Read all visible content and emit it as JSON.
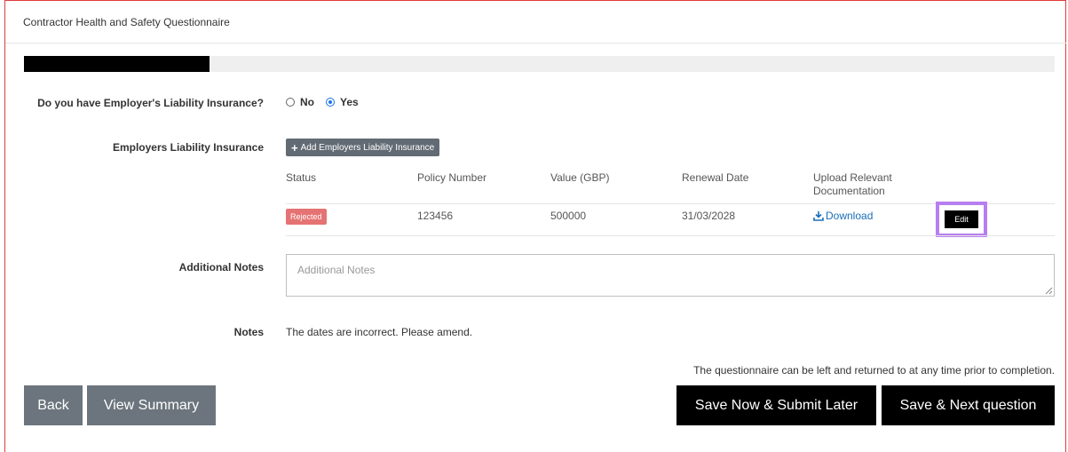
{
  "header": {
    "title": "Contractor Health and Safety Questionnaire"
  },
  "progress": {
    "fraction": 0.18
  },
  "question": {
    "label": "Do you have Employer's Liability Insurance?",
    "options": [
      {
        "label": "No",
        "selected": false
      },
      {
        "label": "Yes",
        "selected": true
      }
    ]
  },
  "insurance": {
    "label": "Employers Liability Insurance",
    "add_button_label": "Add Employers Liability Insurance",
    "columns": [
      "Status",
      "Policy Number",
      "Value (GBP)",
      "Renewal Date",
      "Upload Relevant Documentation"
    ],
    "rows": [
      {
        "status": "Rejected",
        "policy_number": "123456",
        "value": "500000",
        "renewal_date": "31/03/2028",
        "download_label": "Download",
        "edit_label": "Edit"
      }
    ]
  },
  "additional_notes": {
    "label": "Additional Notes",
    "placeholder": "Additional Notes",
    "value": ""
  },
  "notes": {
    "label": "Notes",
    "text": "The dates are incorrect. Please amend."
  },
  "footer": {
    "message": "The questionnaire can be left and returned to at any time prior to completion.",
    "back_label": "Back",
    "view_summary_label": "View Summary",
    "save_later_label": "Save Now & Submit Later",
    "save_next_label": "Save & Next question"
  },
  "colors": {
    "progress_fill": "#000000",
    "rejected_badge": "#e57373",
    "edit_highlight": "#b77ff0",
    "link": "#1a6fb8"
  },
  "icons": [
    "plus-icon",
    "download-icon",
    "resize-grip-icon"
  ]
}
